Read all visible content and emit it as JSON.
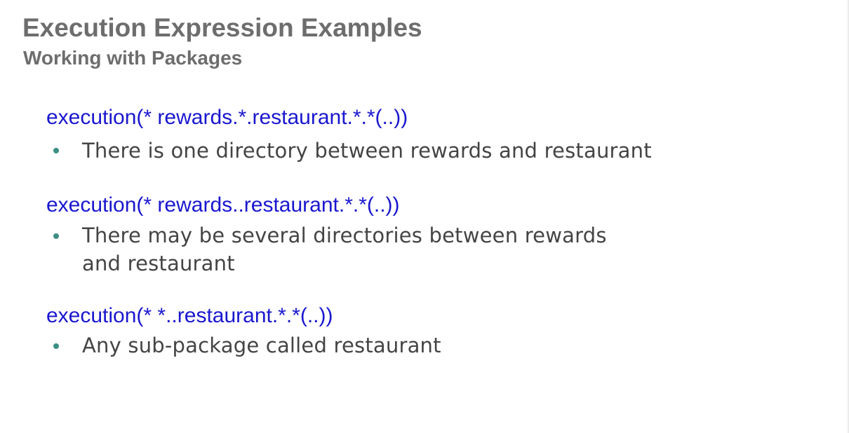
{
  "slide": {
    "title": "Execution Expression Examples",
    "subtitle": "Working with Packages",
    "items": [
      {
        "expression": "execution(* rewards.*.restaurant.*.*(..))",
        "bullet": "There is one directory between rewards and restaurant"
      },
      {
        "expression": "execution(* rewards..restaurant.*.*(..))",
        "bullet": "There may be several directories between rewards and restaurant"
      },
      {
        "expression": "execution(* *..restaurant.*.*(..))",
        "bullet": "Any sub-package called restaurant"
      }
    ]
  },
  "colors": {
    "title": "#6d6d6d",
    "expression": "#1a17cf",
    "bullet_dot": "#3d8f83",
    "bullet_text": "#444444"
  }
}
